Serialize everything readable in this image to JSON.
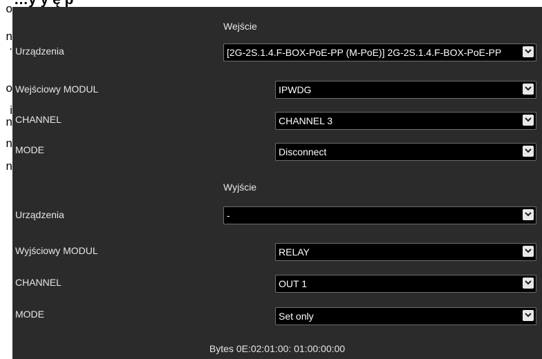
{
  "background": {
    "title_fragment": "…y  y ę p",
    "left_fragments": [
      "o",
      "n",
      ".",
      "o",
      "i",
      "n",
      "n",
      "n"
    ]
  },
  "input_section": {
    "header": "Wejście",
    "rows": [
      {
        "label": "Urządzenia",
        "value": "[2G-2S.1.4.F-BOX-PoE-PP (M-PoE)] 2G-2S.1.4.F-BOX-PoE-PP"
      },
      {
        "label": "Wejściowy MODUL",
        "value": "IPWDG"
      },
      {
        "label": "CHANNEL",
        "value": "CHANNEL 3"
      },
      {
        "label": "MODE",
        "value": "Disconnect"
      }
    ]
  },
  "output_section": {
    "header": "Wyjście",
    "rows": [
      {
        "label": "Urządzenia",
        "value": "-"
      },
      {
        "label": "Wyjściowy MODUL",
        "value": "RELAY"
      },
      {
        "label": "CHANNEL",
        "value": "OUT 1"
      },
      {
        "label": "MODE",
        "value": "Set only"
      }
    ]
  },
  "footer": {
    "bytes_text": "Bytes 0E:02:01:00: 01:00:00:00"
  },
  "colors": {
    "panel_bg": "#2b2b2b",
    "field_bg": "#000000",
    "field_border": "#6e6e6e",
    "text": "#e6e6e6"
  },
  "icons": {
    "dropdown": "chevron-down-icon"
  }
}
